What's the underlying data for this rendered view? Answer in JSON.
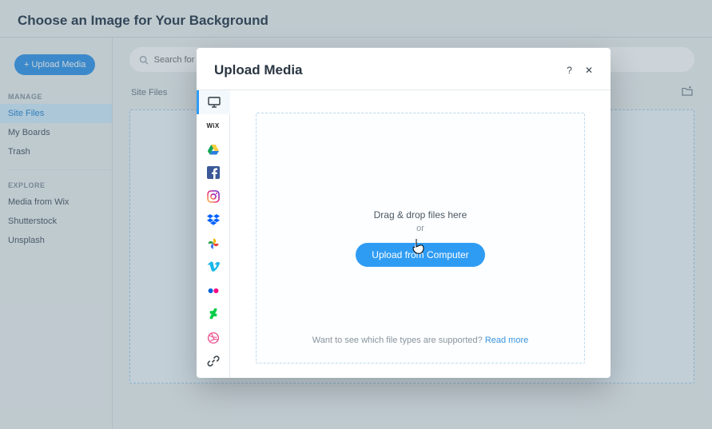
{
  "pageTitle": "Choose an Image for Your Background",
  "sidebar": {
    "uploadButton": "+ Upload Media",
    "sections": {
      "manage": {
        "heading": "MANAGE",
        "items": [
          "Site Files",
          "My Boards",
          "Trash"
        ],
        "activeIndex": 0
      },
      "explore": {
        "heading": "EXPLORE",
        "items": [
          "Media from Wix",
          "Shutterstock",
          "Unsplash"
        ]
      }
    }
  },
  "search": {
    "placeholder": "Search for bu"
  },
  "breadcrumb": "Site Files",
  "modal": {
    "title": "Upload Media",
    "helpLabel": "?",
    "closeLabel": "✕",
    "sources": [
      {
        "id": "computer",
        "label": "My Computer"
      },
      {
        "id": "wix",
        "label": "Wix"
      },
      {
        "id": "google-drive",
        "label": "Google Drive"
      },
      {
        "id": "facebook",
        "label": "Facebook"
      },
      {
        "id": "instagram",
        "label": "Instagram"
      },
      {
        "id": "dropbox",
        "label": "Dropbox"
      },
      {
        "id": "google-photos",
        "label": "Google Photos"
      },
      {
        "id": "vimeo",
        "label": "Vimeo"
      },
      {
        "id": "flickr",
        "label": "Flickr"
      },
      {
        "id": "deviantart",
        "label": "DeviantArt"
      },
      {
        "id": "dribbble",
        "label": "Dribbble"
      },
      {
        "id": "url",
        "label": "URL"
      }
    ],
    "activeSourceIndex": 0,
    "dragText": "Drag & drop files here",
    "orText": "or",
    "cta": "Upload from Computer",
    "supportText": "Want to see which file types are supported? ",
    "readMore": "Read more"
  },
  "colors": {
    "accent": "#2f9cf4",
    "backdrop": "rgba(71,99,118,.28)"
  }
}
